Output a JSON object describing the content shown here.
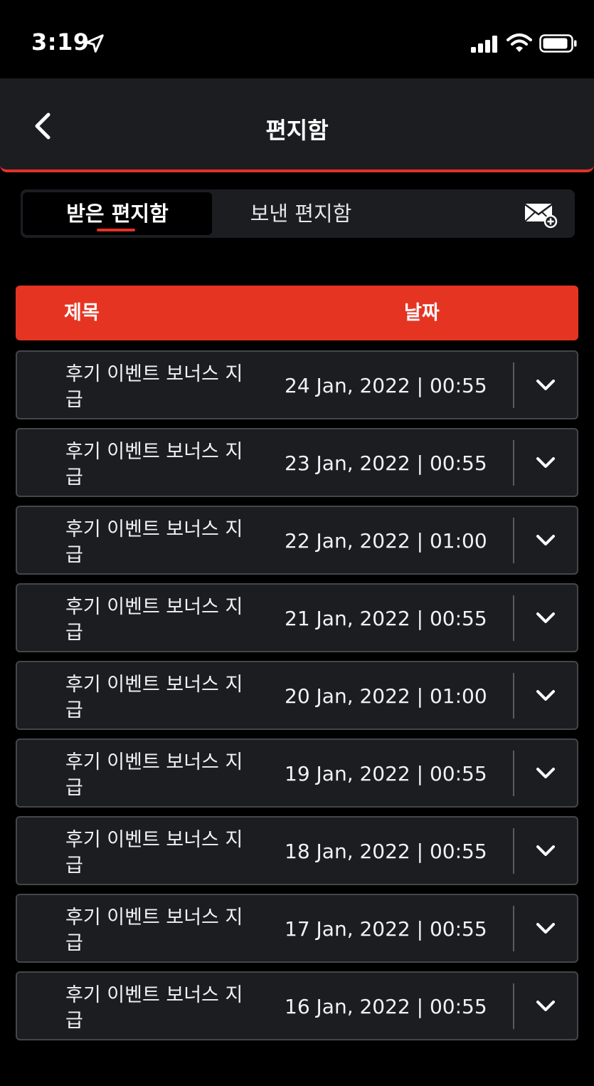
{
  "status_bar": {
    "time": "3:19"
  },
  "header": {
    "title": "편지함"
  },
  "tabs": [
    {
      "label": "받은 편지함",
      "active": true
    },
    {
      "label": "보낸 편지함",
      "active": false
    }
  ],
  "table": {
    "columns": [
      "제목",
      "날짜"
    ],
    "rows": [
      {
        "subject": "후기 이벤트 보너스 지급",
        "date": "24 Jan, 2022 | 00:55"
      },
      {
        "subject": "후기 이벤트 보너스 지급",
        "date": "23 Jan, 2022 | 00:55"
      },
      {
        "subject": "후기 이벤트 보너스 지급",
        "date": "22 Jan, 2022 | 01:00"
      },
      {
        "subject": "후기 이벤트 보너스 지급",
        "date": "21 Jan, 2022 | 00:55"
      },
      {
        "subject": "후기 이벤트 보너스 지급",
        "date": "20 Jan, 2022 | 01:00"
      },
      {
        "subject": "후기 이벤트 보너스 지급",
        "date": "19 Jan, 2022 | 00:55"
      },
      {
        "subject": "후기 이벤트 보너스 지급",
        "date": "18 Jan, 2022 | 00:55"
      },
      {
        "subject": "후기 이벤트 보너스 지급",
        "date": "17 Jan, 2022 | 00:55"
      },
      {
        "subject": "후기 이벤트 보너스 지급",
        "date": "16 Jan, 2022 | 00:55"
      }
    ]
  },
  "colors": {
    "accent": "#e43126",
    "background": "#000000",
    "surface": "#1c1d21",
    "border": "#45464b"
  },
  "icons": [
    "location-arrow-icon",
    "cellular-signal-icon",
    "wifi-icon",
    "battery-icon",
    "back-chevron-icon",
    "compose-mail-icon",
    "chevron-down-icon"
  ]
}
